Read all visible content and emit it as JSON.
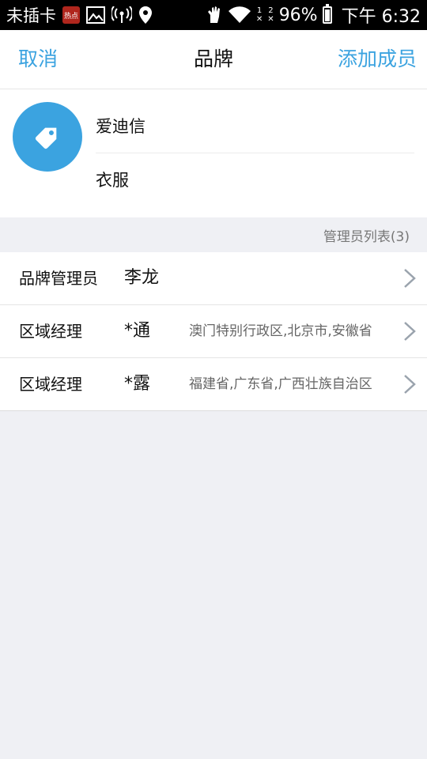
{
  "status_bar": {
    "carrier": "未插卡",
    "app_badge": "热点",
    "sim1": "1",
    "sim2": "2",
    "battery": "96%",
    "time": "下午 6:32"
  },
  "nav": {
    "cancel_label": "取消",
    "title": "品牌",
    "add_label": "添加成员"
  },
  "brand": {
    "icon": "tag-icon",
    "name": "爱迪信",
    "category": "衣服"
  },
  "admin_list": {
    "header": "管理员列表(3)",
    "rows": [
      {
        "role": "品牌管理员",
        "name": "李龙",
        "regions": ""
      },
      {
        "role": "区域经理",
        "name": "*通",
        "regions": "澳门特别行政区,北京市,安徽省"
      },
      {
        "role": "区域经理",
        "name": "*露",
        "regions": "福建省,广东省,广西壮族自治区"
      }
    ]
  },
  "colors": {
    "accent": "#3ba3e0",
    "background": "#eff0f4"
  }
}
